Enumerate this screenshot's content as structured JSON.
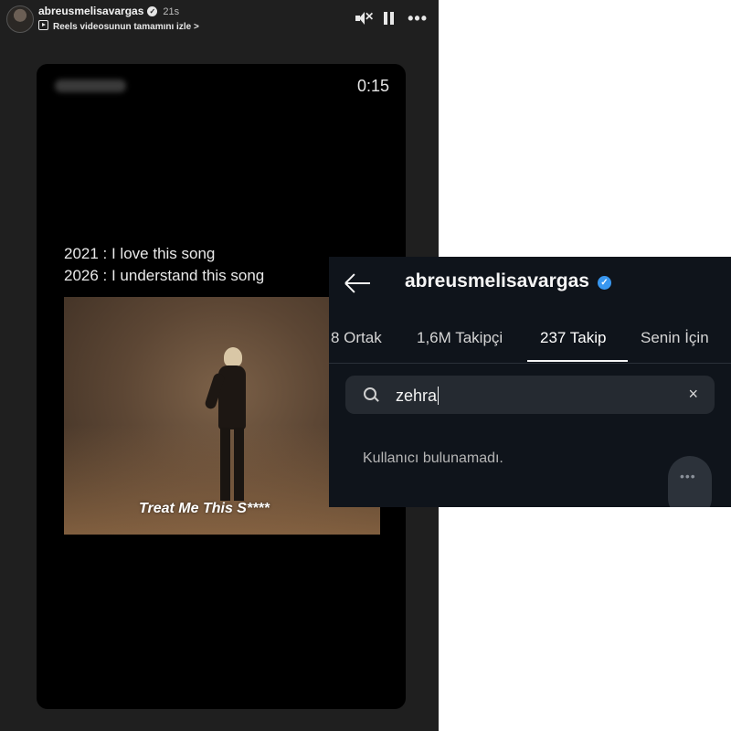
{
  "story": {
    "username": "abreusmelisavargas",
    "time": "21s",
    "reels_link": "Reels videosunun tamamını izle",
    "reels_chevron": ">",
    "more": "•••",
    "video": {
      "timer": "0:15",
      "caption_line1": "2021 : I love this song",
      "caption_line2": "2026 : I understand this song",
      "lyric": "Treat Me This S****"
    }
  },
  "following": {
    "username": "abreusmelisavargas",
    "tabs": [
      {
        "label": "8 Ortak"
      },
      {
        "label": "1,6M Takipçi"
      },
      {
        "label": "237 Takip"
      },
      {
        "label": "Senin İçin"
      }
    ],
    "active_tab": "237 Takip",
    "search": {
      "value": "zehra"
    },
    "clear": "×",
    "empty_message": "Kullanıcı bulunamadı.",
    "floating_button": "•••"
  },
  "colors": {
    "verified_blue": "#3897f0",
    "panel_dark": "#0f141b",
    "story_bg": "#1f1f1f"
  },
  "icons": [
    "mute-icon",
    "pause-icon",
    "more-icon",
    "back-arrow-icon",
    "verified-icon",
    "search-icon",
    "close-icon",
    "reels-icon"
  ]
}
